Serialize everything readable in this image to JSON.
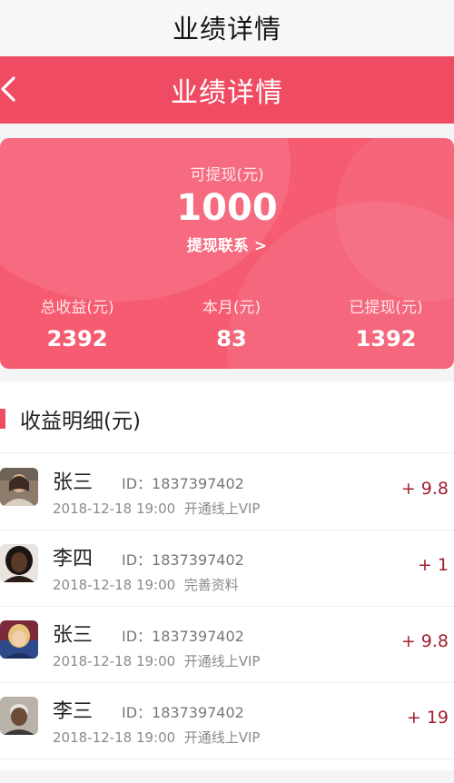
{
  "page": {
    "title": "业绩详情"
  },
  "nav": {
    "back_icon": "chevron-left-icon",
    "title": "业绩详情"
  },
  "summary": {
    "available_label": "可提现(元)",
    "available_value": "1000",
    "withdraw_link": "提现联系 >",
    "stats": [
      {
        "label": "总收益(元)",
        "value": "2392"
      },
      {
        "label": "本月(元)",
        "value": "83"
      },
      {
        "label": "已提现(元)",
        "value": "1392"
      }
    ]
  },
  "details": {
    "title": "收益明细(元)",
    "items": [
      {
        "name": "张三",
        "id": "ID：1837397402",
        "time": "2018-12-18 19:00",
        "desc": "开通线上VIP",
        "amount": "+ 9.8"
      },
      {
        "name": "李四",
        "id": "ID：1837397402",
        "time": "2018-12-18 19:00",
        "desc": "完善资料",
        "amount": "+ 1"
      },
      {
        "name": "张三",
        "id": "ID：1837397402",
        "time": "2018-12-18 19:00",
        "desc": "开通线上VIP",
        "amount": "+ 9.8"
      },
      {
        "name": "李三",
        "id": "ID：1837397402",
        "time": "2018-12-18 19:00",
        "desc": "开通线上VIP",
        "amount": "+ 19"
      }
    ]
  },
  "colors": {
    "accent": "#ef4b62",
    "card": "#f55b71",
    "amount": "#a2202e"
  }
}
